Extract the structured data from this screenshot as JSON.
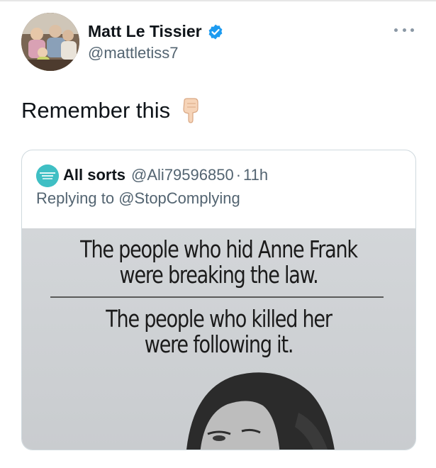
{
  "tweet": {
    "author_name": "Matt Le Tissier",
    "author_handle": "@mattletiss7",
    "text": "Remember this",
    "icons": {
      "avatar": "profile-photo",
      "verified": "verified-badge-icon",
      "more": "more-options-icon",
      "emoji": "pointing-down-emoji"
    }
  },
  "quoted": {
    "name": "All sorts",
    "handle": "@Ali79596850",
    "separator": "·",
    "time": "11h",
    "reply_prefix": "Replying to",
    "reply_handle": "@StopComplying",
    "meme": {
      "line1": "The people who hid Anne Frank",
      "line2": "were breaking the law.",
      "line3": "The people who killed her",
      "line4": "were following it."
    }
  },
  "colors": {
    "verified_blue": "#1d9bf0",
    "secondary_text": "#536471",
    "border": "#cfd9de"
  }
}
